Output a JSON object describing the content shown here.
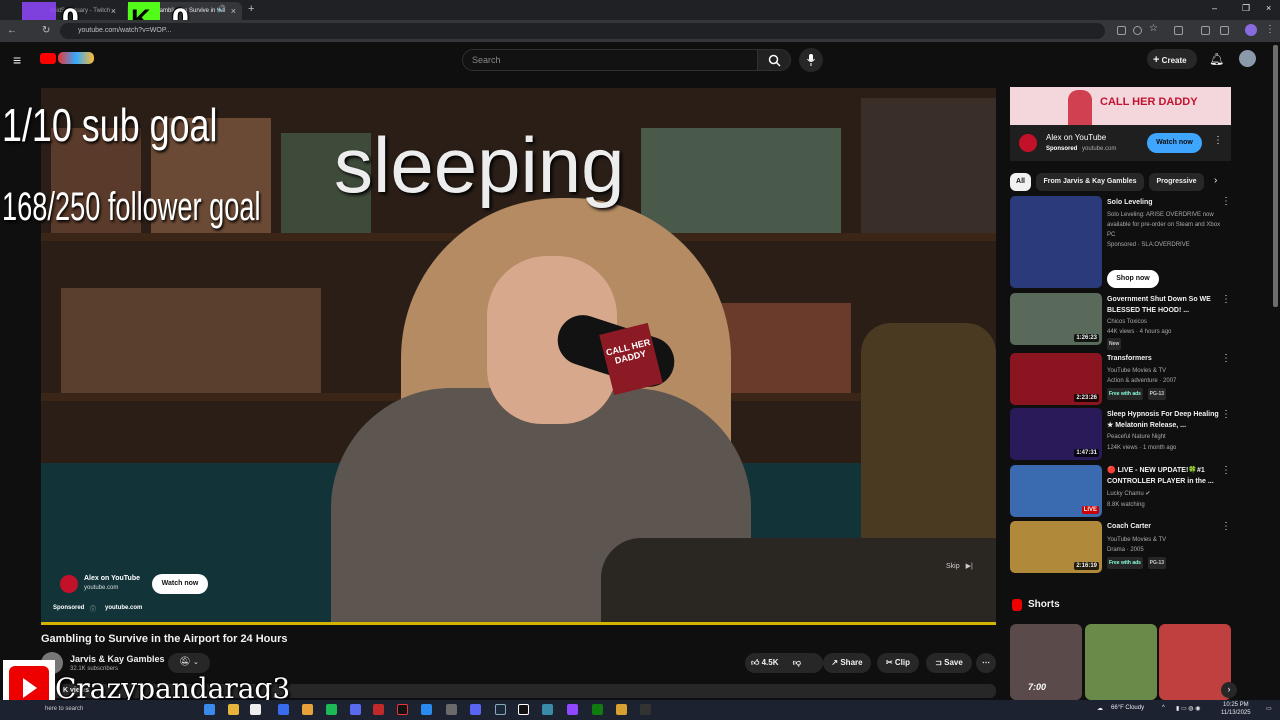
{
  "browser": {
    "tabs": [
      {
        "label": "voidSanctuary - Twitch",
        "active": false
      },
      {
        "label": "Gambling to Survive in the",
        "active": true
      }
    ],
    "new_tab": "+",
    "url": "youtube.com/watch?v=WOP..."
  },
  "overlay": {
    "counter_left": "0",
    "counter_right": "0",
    "sub_goal": "1/10 sub goal",
    "follower_goal": "168/250 follower goal",
    "status": "sleeping",
    "streamer": "Crazypandarag3"
  },
  "header": {
    "search_placeholder": "Search",
    "create_label": "Create"
  },
  "player": {
    "mic_flag": "CALL HER DADDY",
    "ad": {
      "channel": "Alex on YouTube",
      "url": "youtube.com",
      "watch_label": "Watch now",
      "sponsored": "Sponsored",
      "sponsored_url": "youtube.com"
    },
    "skip_label": "Skip"
  },
  "video": {
    "title": "Gambling to Survive in the Airport for 24 Hours",
    "channel": "Jarvis & Kay Gambles",
    "subscribers": "32.1K subscribers",
    "likes": "4.5K",
    "share_label": "Share",
    "clip_label": "Clip",
    "save_label": "Save",
    "views_partial": "K views"
  },
  "sidebar": {
    "banner_text": "CALL HER DADDY",
    "ad": {
      "channel": "Alex on YouTube",
      "sponsored": "Sponsored",
      "url": "youtube.com",
      "watch_label": "Watch now"
    },
    "chips": [
      "All",
      "From Jarvis & Kay Gambles",
      "Progressive"
    ],
    "recommendations": [
      {
        "title": "Solo Leveling",
        "meta1": "Solo Leveling: ARISE OVERDRIVE now available for pre-order on Steam and Xbox PC",
        "meta2": "Sponsored · SLA:OVERDRIVE",
        "duration": "",
        "thumb_color": "#2b3a7a",
        "cta": "Shop now"
      },
      {
        "title": "Government Shut Down So WE BLESSED THE HOOD! ...",
        "meta1": "Chicos Toxicos",
        "meta2": "44K views · 4 hours ago",
        "badge": "New",
        "duration": "1:26:23",
        "thumb_color": "#5a6a5a"
      },
      {
        "title": "Transformers",
        "meta1": "YouTube Movies & TV",
        "meta2": "Action & adventure · 2007",
        "badge": "Free with ads",
        "badge2": "PG-13",
        "duration": "2:23:26",
        "thumb_color": "#8a1420"
      },
      {
        "title": "Sleep Hypnosis For Deep Healing ★ Melatonin Release, ...",
        "meta1": "Peaceful Nature Night",
        "meta2": "124K views · 1 month ago",
        "duration": "1:47:31",
        "thumb_color": "#2a1a5a"
      },
      {
        "title": "🔴 LIVE - NEW UPDATE!🍀#1 CONTROLLER PLAYER in the ...",
        "meta1": "Lucky Chamu ✔",
        "meta2": "8.8K watching",
        "duration": "LIVE",
        "thumb_color": "#3a6ab0"
      },
      {
        "title": "Coach Carter",
        "meta1": "YouTube Movies & TV",
        "meta2": "Drama · 2005",
        "badge": "Free with ads",
        "badge2": "PG-13",
        "duration": "2:16:19",
        "thumb_color": "#b08a3a"
      }
    ],
    "shorts_label": "Shorts",
    "shorts": [
      {
        "color": "#5a4a4a",
        "label": "7:00"
      },
      {
        "color": "#6a8a4a",
        "label": ""
      },
      {
        "color": "#c04040",
        "label": ""
      }
    ]
  },
  "taskbar": {
    "search_text": "here to search",
    "weather": "66°F  Cloudy",
    "time": "10:25 PM",
    "date": "11/13/2025"
  }
}
